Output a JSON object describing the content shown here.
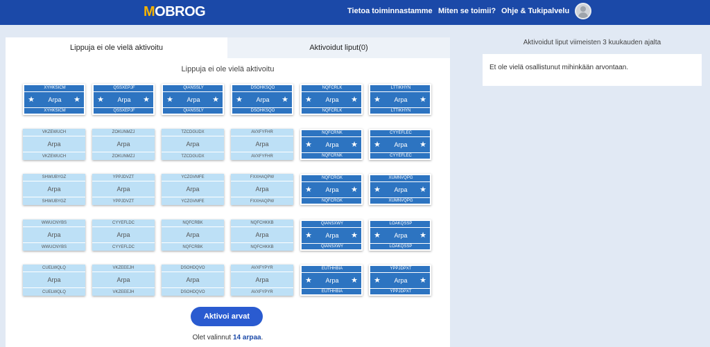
{
  "header": {
    "logo": {
      "first": "M",
      "rest": "OBROG"
    },
    "nav": [
      "Tietoa toiminnastamme",
      "Miten se toimii?",
      "Ohje & Tukipalvelu"
    ]
  },
  "tabs": [
    "Lippuja ei ole vielä aktivoitu",
    "Aktivoidut liput(0)"
  ],
  "section_title": "Lippuja ei ole vielä aktivoitu",
  "ticket_label": "Arpa",
  "tickets": [
    [
      {
        "code": "XYHKSICM",
        "active": true
      },
      {
        "code": "QSSXEPJF",
        "active": true
      },
      {
        "code": "QIANSSLY",
        "active": true
      },
      {
        "code": "DSOHKSQO",
        "active": true
      },
      {
        "code": "NQFCRLK",
        "active": true
      },
      {
        "code": "LTTIKHYN",
        "active": true
      }
    ],
    [
      {
        "code": "VKZEWUCH",
        "active": false
      },
      {
        "code": "ZOKUNMZJ",
        "active": false
      },
      {
        "code": "TZCDGUDX",
        "active": false
      },
      {
        "code": "AVXFYFHR",
        "active": false
      },
      {
        "code": "NQFCRNK",
        "active": true
      },
      {
        "code": "CYYEFLEC",
        "active": true
      }
    ],
    [
      {
        "code": "SHWUBYGZ",
        "active": false
      },
      {
        "code": "YPPJDVZT",
        "active": false
      },
      {
        "code": "YCZGVMFE",
        "active": false
      },
      {
        "code": "FXXHAQPW",
        "active": false
      },
      {
        "code": "NQFCRGK",
        "active": true
      },
      {
        "code": "XUMNVQPG",
        "active": true
      }
    ],
    [
      {
        "code": "WWUCNYBS",
        "active": false
      },
      {
        "code": "CYYEFLDC",
        "active": false
      },
      {
        "code": "NQFCRBK",
        "active": false
      },
      {
        "code": "NQFCHKKB",
        "active": false
      },
      {
        "code": "QIANSXWY",
        "active": true
      },
      {
        "code": "LOAKQSSP",
        "active": true
      }
    ],
    [
      {
        "code": "CUELWQLQ",
        "active": false
      },
      {
        "code": "VKZEEEJH",
        "active": false
      },
      {
        "code": "DSOHDQVO",
        "active": false
      },
      {
        "code": "AVXFYPYR",
        "active": false
      },
      {
        "code": "EUTHHBIA",
        "active": true
      },
      {
        "code": "YPPJDPXT",
        "active": true
      }
    ]
  ],
  "activate_button": "Aktivoi arvat",
  "selection": {
    "prefix": "Olet valinnut ",
    "count": "14 arpaa",
    "suffix": "."
  },
  "right_panel": {
    "title": "Aktivoidut liput viimeisten 3 kuukauden ajalta",
    "message": "Et ole vielä osallistunut mihinkään arvontaan."
  }
}
